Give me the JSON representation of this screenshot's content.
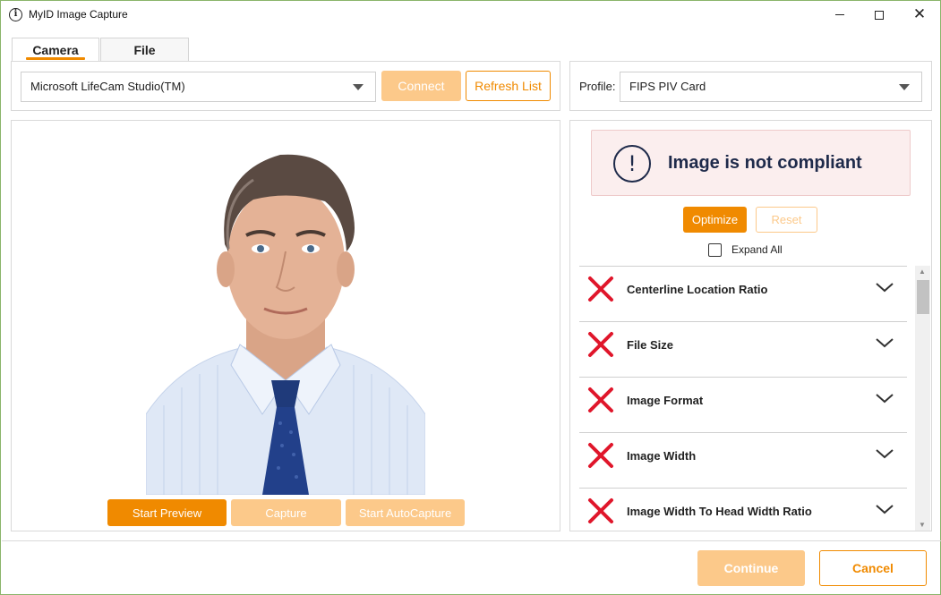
{
  "window": {
    "title": "MyID Image Capture",
    "minimize_icon": "minimize-icon",
    "maximize_icon": "maximize-icon",
    "close_icon": "close-icon"
  },
  "tabs": [
    {
      "label": "Camera",
      "active": true
    },
    {
      "label": "File",
      "active": false
    }
  ],
  "camera": {
    "selected_device": "Microsoft LifeCam Studio(TM)",
    "connect_label": "Connect",
    "refresh_label": "Refresh List"
  },
  "profile": {
    "label": "Profile:",
    "selected": "FIPS PIV Card"
  },
  "capture_buttons": {
    "start_preview": "Start Preview",
    "capture": "Capture",
    "start_autocapture": "Start AutoCapture"
  },
  "compliance": {
    "status_text": "Image is not compliant",
    "status_icon": "exclamation-circle-icon",
    "optimize_label": "Optimize",
    "reset_label": "Reset",
    "expand_all_label": "Expand All",
    "expand_all_checked": false,
    "items": [
      {
        "label": "Centerline Location Ratio",
        "status": "fail"
      },
      {
        "label": "File Size",
        "status": "fail"
      },
      {
        "label": "Image Format",
        "status": "fail"
      },
      {
        "label": "Image Width",
        "status": "fail"
      },
      {
        "label": "Image Width To Head Width Ratio",
        "status": "fail"
      }
    ]
  },
  "footer": {
    "continue_label": "Continue",
    "cancel_label": "Cancel"
  },
  "colors": {
    "accent": "#f08a00",
    "accent_disabled": "#fcc98a",
    "fail_red": "#e0162b",
    "alert_bg": "#fbeeee",
    "alert_text": "#1e2a4a"
  }
}
